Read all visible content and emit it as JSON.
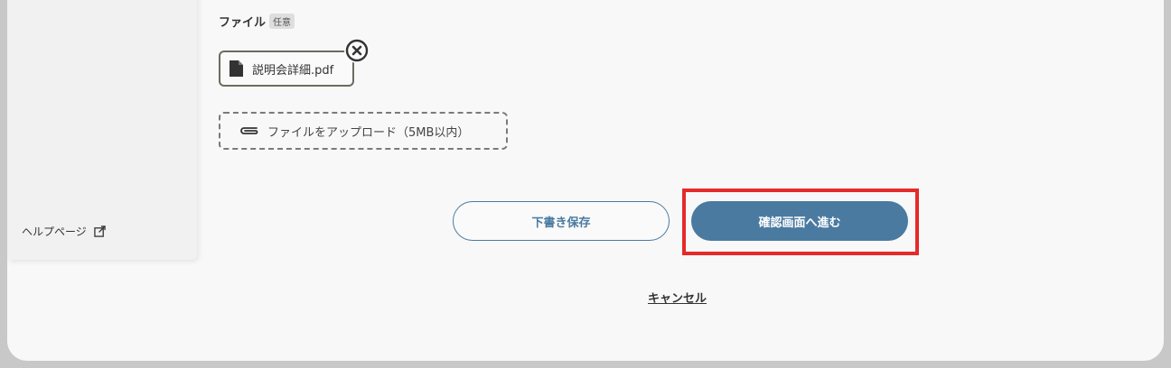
{
  "sidebar": {
    "help_link_label": "ヘルプページ",
    "help_icon": "external-link-icon"
  },
  "file_field": {
    "label": "ファイル",
    "badge": "任意",
    "attached_file": {
      "name": "説明会詳細.pdf",
      "icon": "file-icon",
      "remove_icon": "close-circle-icon"
    },
    "upload_button": {
      "label": "ファイルをアップロード（5MB以内）",
      "icon": "paperclip-icon"
    }
  },
  "actions": {
    "draft_label": "下書き保存",
    "confirm_label": "確認画面へ進む",
    "cancel_label": "キャンセル"
  },
  "colors": {
    "primary": "#4a7aa0",
    "highlight": "#e52a2a"
  }
}
